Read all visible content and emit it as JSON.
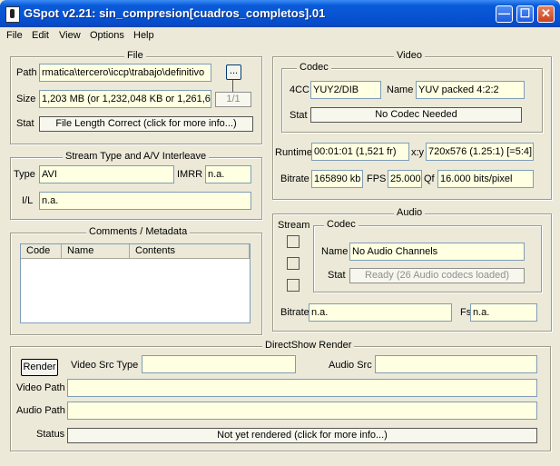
{
  "window": {
    "title": "GSpot v2.21: sin_compresion[cuadros_completos].01"
  },
  "menu": [
    "File",
    "Edit",
    "View",
    "Options",
    "Help"
  ],
  "file": {
    "group_title": "File",
    "path_label": "Path",
    "path_value": "rmatica\\tercero\\iccp\\trabajo\\definitivo",
    "browse_label": "...",
    "size_label": "Size",
    "size_value": "1,203 MB (or 1,232,048 KB or 1,261,6",
    "page_counter": "1/1",
    "stat_label": "Stat",
    "stat_value": "File Length Correct (click for more info...)"
  },
  "stream": {
    "group_title": "Stream Type and A/V Interleave",
    "type_label": "Type",
    "type_value": "AVI",
    "imrr_label": "IMRR",
    "imrr_value": "n.a.",
    "il_label": "I/L",
    "il_value": "n.a."
  },
  "comments": {
    "group_title": "Comments / Metadata",
    "columns": [
      "Code",
      "Name",
      "Contents"
    ]
  },
  "video": {
    "group_title": "Video",
    "codec_title": "Codec",
    "fourcc_label": "4CC",
    "fourcc_value": "YUY2/DIB",
    "name_label": "Name",
    "name_value": "YUV packed 4:2:2",
    "stat_label": "Stat",
    "stat_value": "No Codec Needed",
    "runtime_label": "Runtime",
    "runtime_value": "00:01:01 (1,521 fr)",
    "xy_label": "x:y",
    "xy_value": "720x576 (1.25:1) [=5:4]",
    "bitrate_label": "Bitrate",
    "bitrate_value": "165890 kb",
    "fps_label": "FPS",
    "fps_value": "25.000",
    "qf_label": "Qf",
    "qf_value": "16.000 bits/pixel"
  },
  "audio": {
    "group_title": "Audio",
    "stream_label": "Stream",
    "codec_title": "Codec",
    "name_label": "Name",
    "name_value": "No Audio Channels",
    "stat_label": "Stat",
    "stat_value": "Ready (26 Audio codecs loaded)",
    "bitrate_label": "Bitrate",
    "bitrate_value": "n.a.",
    "fs_label": "Fs",
    "fs_value": "n.a."
  },
  "render": {
    "group_title": "DirectShow Render",
    "render_button": "Render",
    "video_src_type_label": "Video Src Type",
    "audio_src_label": "Audio Src",
    "video_path_label": "Video Path",
    "audio_path_label": "Audio Path",
    "status_label": "Status",
    "status_value": "Not yet rendered (click for more info...)"
  }
}
